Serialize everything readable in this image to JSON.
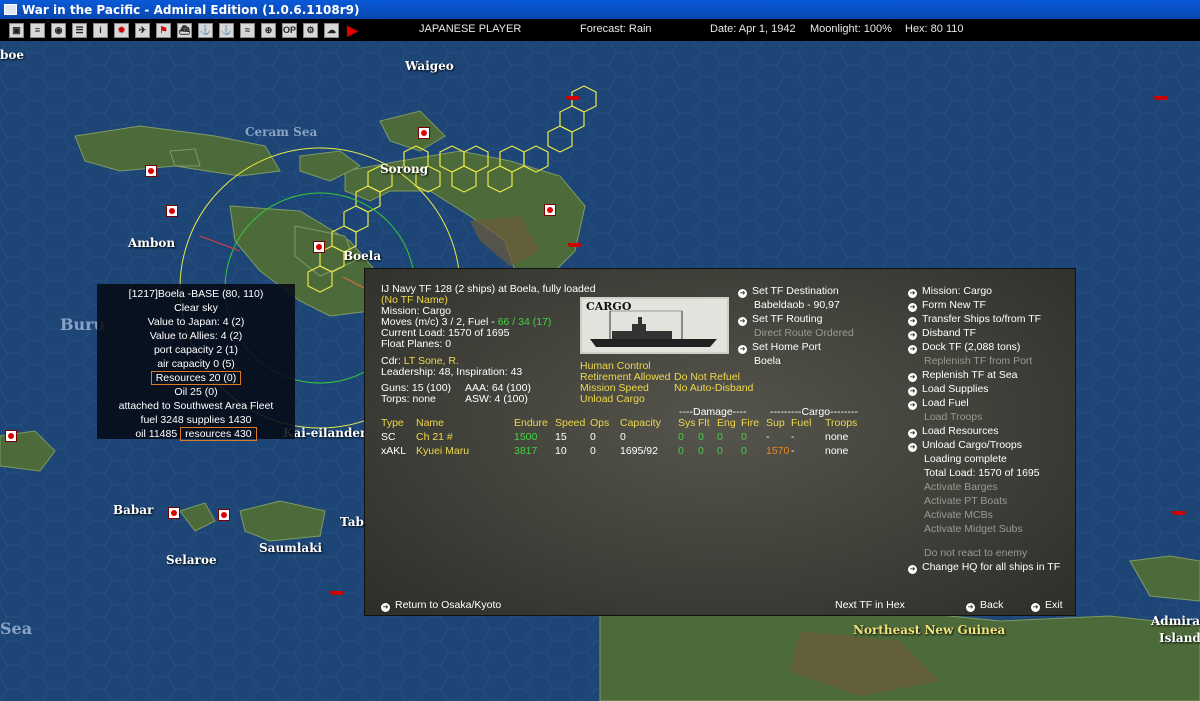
{
  "window": {
    "title": "War in the Pacific - Admiral Edition (1.0.6.1108r9)"
  },
  "toolbar": {
    "player": "JAPANESE PLAYER",
    "forecast": "Forecast: Rain",
    "date": "Date: Apr 1, 1942",
    "moonlight": "Moonlight: 100%",
    "hex": "Hex: 80 110"
  },
  "map": {
    "labels": {
      "waigeo": "Waigeo",
      "sorong": "Sorong",
      "boela": "Boela",
      "ambon": "Ambon",
      "babar": "Babar",
      "selaroe": "Selaroe",
      "saumlaki": "Saumlaki",
      "kai": "Kai-eilanden",
      "tab": "Tab",
      "png": "Northeast New Guinea",
      "admira": "Admira",
      "island": "Island",
      "sea": "Sea",
      "boe": "boe",
      "ceram": "Ceram Sea",
      "bur": "Buru"
    }
  },
  "basebox": {
    "title": "[1217]Boela  -BASE  (80, 110)",
    "weather": "Clear sky",
    "vjapan": "Value to Japan:  4 (2)",
    "vallies": "Value to Allies:  4 (2)",
    "port": "port capacity 2 (1)",
    "air": "air capacity 0 (5)",
    "resources": "Resources  20 (0)",
    "oil": "Oil  25 (0)",
    "attached": "attached to Southwest Area Fleet",
    "fuelsup": "fuel 3248  supplies 1430",
    "oilline": "oil 11485",
    "resline": "resources 430"
  },
  "tf": {
    "header": "IJ Navy TF 128 (2 ships) at Boela, fully loaded",
    "noname": "(No TF Name)",
    "mission": "Mission: Cargo",
    "moves": "Moves (m/c) 3 / 2, Fuel - ",
    "fuel": "66 / 34 (17)",
    "load": "Current Load: 1570 of 1695",
    "float": "Float Planes: 0",
    "cdr_label": "Cdr:",
    "cdr": "LT Sone, R.",
    "leadership": "Leadership: 48, Inspiration: 43",
    "guns": "Guns: 15 (100)",
    "aaa": "AAA: 64 (100)",
    "torps": "Torps: none",
    "asw": "ASW: 4 (100)",
    "image_label": "CARGO",
    "opts_a": [
      "Human Control",
      "Retirement Allowed",
      "Mission Speed",
      "Unload Cargo"
    ],
    "opts_b": [
      "Do Not Refuel",
      "No Auto-Disband"
    ],
    "mid": {
      "dest": "Set TF Destination",
      "dest_val": "Babeldaob - 90,97",
      "routing": "Set TF Routing",
      "routing_val": "Direct Route Ordered",
      "home": "Set Home Port",
      "home_val": "Boela"
    },
    "right": {
      "mission": "Mission: Cargo",
      "formnew": "Form New TF",
      "transfer": "Transfer Ships to/from TF",
      "disband": "Disband TF",
      "dock": "Dock TF (2,088 tons)",
      "replport": "Replenish TF from Port",
      "replsea": "Replenish TF at Sea",
      "loadsup": "Load Supplies",
      "loadfuel": "Load Fuel",
      "loadtroops": "Load Troops",
      "loadres": "Load Resources",
      "unload": "Unload Cargo/Troops",
      "loading": "Loading complete",
      "total": "Total Load: 1570 of 1695",
      "barges": "Activate Barges",
      "pt": "Activate PT Boats",
      "mcb": "Activate MCBs",
      "midget": "Activate Midget Subs",
      "noreact": "Do not react to enemy",
      "changehq": "Change HQ for all ships in TF"
    },
    "groups": {
      "damage": "----Damage----",
      "cargo": "---------Cargo--------"
    },
    "cols": [
      "Type",
      "Name",
      "Endure",
      "Speed",
      "Ops",
      "Capacity",
      "Sys",
      "Flt",
      "Eng",
      "Fire",
      "Sup",
      "Fuel",
      "Troops"
    ],
    "ships": [
      [
        "SC",
        "Ch 21 #",
        "1500",
        "15",
        "0",
        "0",
        "0",
        "0",
        "0",
        "0",
        "-",
        "-",
        "none"
      ],
      [
        "xAKL",
        "Kyuei Maru",
        "3817",
        "10",
        "0",
        "1695/92",
        "0",
        "0",
        "0",
        "0",
        "1570",
        "-",
        "none"
      ]
    ],
    "bottom": {
      "return": "Return to Osaka/Kyoto",
      "next": "Next TF in Hex",
      "back": "Back",
      "exit": "Exit"
    }
  }
}
